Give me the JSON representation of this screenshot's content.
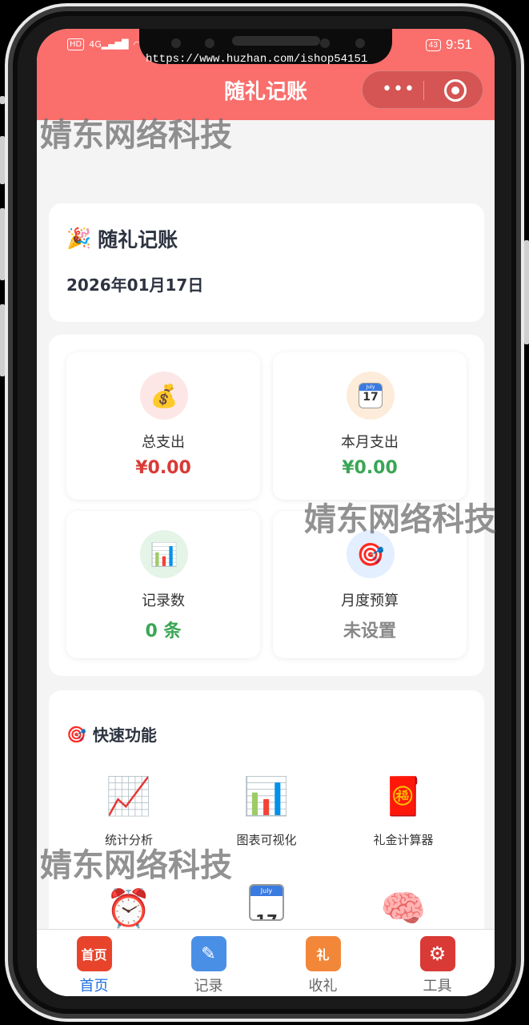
{
  "status_bar": {
    "left": "HD 4G",
    "time": "9:51",
    "battery": "43"
  },
  "url": "https://www.huzhan.com/ishop54151",
  "header": {
    "title": "随礼记账"
  },
  "capsule": {
    "more_icon": "more-dots-icon",
    "close_icon": "target-circle-icon"
  },
  "watermark": "婧东网络科技",
  "welcome": {
    "icon": "party-popper-icon",
    "title": "随礼记账",
    "date": "2026年01月17日"
  },
  "stats": [
    {
      "label": "总支出",
      "value": "¥0.00",
      "icon": "money-bag-icon",
      "color": "#d93a36",
      "bg": "#fde6e6"
    },
    {
      "label": "本月支出",
      "value": "¥0.00",
      "icon": "calendar-icon",
      "color": "#3aa655",
      "bg": "#fdecd9"
    },
    {
      "label": "记录数",
      "value": "0 条",
      "icon": "bar-chart-icon",
      "color": "#3aa655",
      "bg": "#e4f4e7"
    },
    {
      "label": "月度预算",
      "value": "未设置",
      "icon": "target-icon",
      "color": "#888888",
      "bg": "#e3efff"
    }
  ],
  "quick": {
    "title": "快速功能",
    "icon": "target-icon",
    "items": [
      {
        "label": "统计分析",
        "icon": "line-chart-icon"
      },
      {
        "label": "图表可视化",
        "icon": "bar-chart-icon"
      },
      {
        "label": "礼金计算器",
        "icon": "red-envelope-icon"
      },
      {
        "label": "",
        "icon": "alarm-clock-icon"
      },
      {
        "label": "",
        "icon": "calendar-icon"
      },
      {
        "label": "",
        "icon": "brain-icon"
      }
    ]
  },
  "tabs": [
    {
      "label": "首页",
      "icon_text": "首页",
      "active": true
    },
    {
      "label": "记录",
      "icon_text": "✎",
      "active": false
    },
    {
      "label": "收礼",
      "icon_text": "礼",
      "active": false
    },
    {
      "label": "工具",
      "icon_text": "⚙",
      "active": false
    }
  ]
}
